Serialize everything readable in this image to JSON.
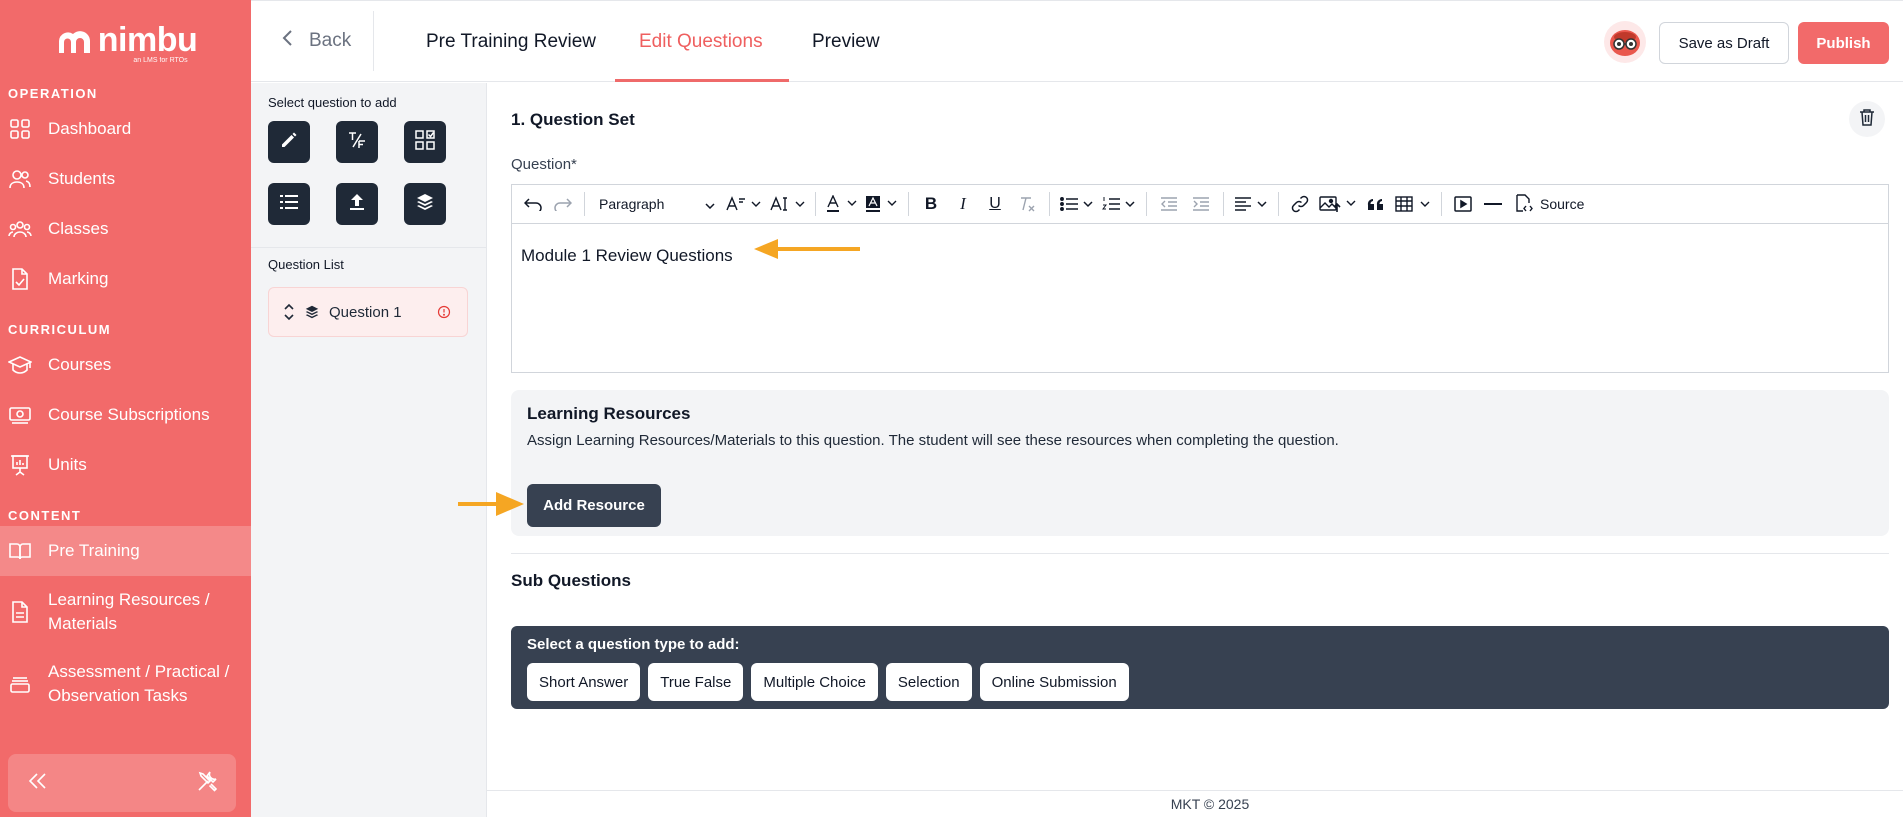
{
  "brand": {
    "name": "nimbu",
    "tagline": "an LMS for RTOs",
    "sidebar_color": "#f26a6a",
    "accent": "#ef5f5f"
  },
  "sidebar": {
    "sections": [
      {
        "label": "OPERATION",
        "items": [
          {
            "label": "Dashboard",
            "icon": "grid-icon"
          },
          {
            "label": "Students",
            "icon": "users-icon"
          },
          {
            "label": "Classes",
            "icon": "group-icon"
          },
          {
            "label": "Marking",
            "icon": "file-check-icon"
          }
        ]
      },
      {
        "label": "CURRICULUM",
        "items": [
          {
            "label": "Courses",
            "icon": "graduation-cap-icon"
          },
          {
            "label": "Course Subscriptions",
            "icon": "money-icon"
          },
          {
            "label": "Units",
            "icon": "presentation-icon"
          }
        ]
      },
      {
        "label": "CONTENT",
        "items": [
          {
            "label": "Pre Training",
            "icon": "book-open-icon",
            "active": true
          },
          {
            "label": "Learning Resources / Materials",
            "icon": "file-text-icon"
          },
          {
            "label": "Assessment / Practical / Observation Tasks",
            "icon": "layers-box-icon"
          }
        ]
      }
    ],
    "bottom": {
      "collapse_icon": "chevrons-left-icon",
      "tools_icon": "tools-icon"
    }
  },
  "topbar": {
    "back_label": "Back",
    "tabs": [
      {
        "label": "Pre Training Review"
      },
      {
        "label": "Edit Questions",
        "active": true
      },
      {
        "label": "Preview"
      }
    ],
    "save_draft_label": "Save as Draft",
    "publish_label": "Publish"
  },
  "question_panel": {
    "select_label": "Select question to add",
    "types": [
      "pencil-icon",
      "true-false-icon",
      "multiple-choice-icon",
      "list-icon",
      "upload-icon",
      "layers-icon"
    ],
    "list_label": "Question List",
    "questions": [
      {
        "label": "Question 1",
        "warning": true
      }
    ]
  },
  "main": {
    "set_title": "1. Question Set",
    "question_label": "Question*",
    "editor": {
      "paragraph_select": "Paragraph",
      "source_label": "Source",
      "content": "Module 1 Review Questions"
    },
    "resources": {
      "title": "Learning Resources",
      "description": "Assign Learning Resources/Materials to this question. The student will see these resources when completing the question.",
      "add_label": "Add Resource"
    },
    "sub_questions": {
      "title": "Sub Questions",
      "select_label": "Select a question type to add:",
      "types": [
        "Short Answer",
        "True False",
        "Multiple Choice",
        "Selection",
        "Online Submission"
      ]
    },
    "footer": "MKT © 2025"
  }
}
